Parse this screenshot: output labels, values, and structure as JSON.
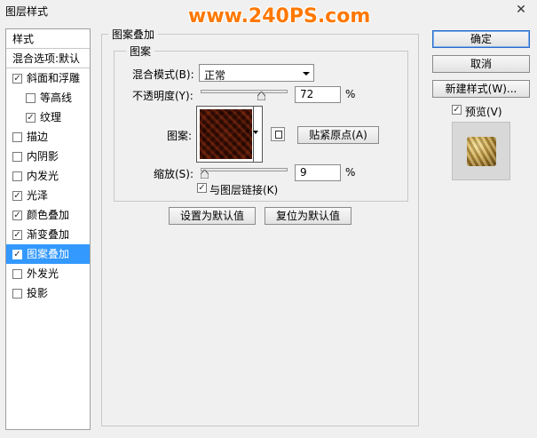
{
  "window": {
    "title": "图层样式",
    "watermark": "www.240PS.com",
    "close_glyph": "✕"
  },
  "left_panel": {
    "header_styles": "样式",
    "header_blending": "混合选项:默认",
    "items": [
      {
        "label": "斜面和浮雕",
        "checked": true,
        "indent": false
      },
      {
        "label": "等高线",
        "checked": false,
        "indent": true
      },
      {
        "label": "纹理",
        "checked": true,
        "indent": true
      },
      {
        "label": "描边",
        "checked": false,
        "indent": false
      },
      {
        "label": "内阴影",
        "checked": false,
        "indent": false
      },
      {
        "label": "内发光",
        "checked": false,
        "indent": false
      },
      {
        "label": "光泽",
        "checked": true,
        "indent": false
      },
      {
        "label": "颜色叠加",
        "checked": true,
        "indent": false
      },
      {
        "label": "渐变叠加",
        "checked": true,
        "indent": false
      },
      {
        "label": "图案叠加",
        "checked": true,
        "indent": false,
        "selected": true
      },
      {
        "label": "外发光",
        "checked": false,
        "indent": false
      },
      {
        "label": "投影",
        "checked": false,
        "indent": false
      }
    ]
  },
  "pattern_overlay": {
    "group_title": "图案叠加",
    "subgroup_title": "图案",
    "blend_mode_label": "混合模式(B):",
    "blend_mode_value": "正常",
    "opacity_label": "不透明度(Y):",
    "opacity_value": "72",
    "opacity_unit": "%",
    "opacity_fraction": 0.72,
    "pattern_label": "图案:",
    "snap_origin_button": "贴紧原点(A)",
    "scale_label": "缩放(S):",
    "scale_value": "9",
    "scale_unit": "%",
    "scale_fraction": 0.0,
    "link_layer_label": "与图层链接(K)",
    "link_layer_checked": true,
    "set_default_button": "设置为默认值",
    "reset_default_button": "复位为默认值"
  },
  "actions": {
    "ok_button": "确定",
    "cancel_button": "取消",
    "new_style_button": "新建样式(W)...",
    "preview_label": "预览(V)",
    "preview_checked": true
  },
  "check_glyph": "✓"
}
